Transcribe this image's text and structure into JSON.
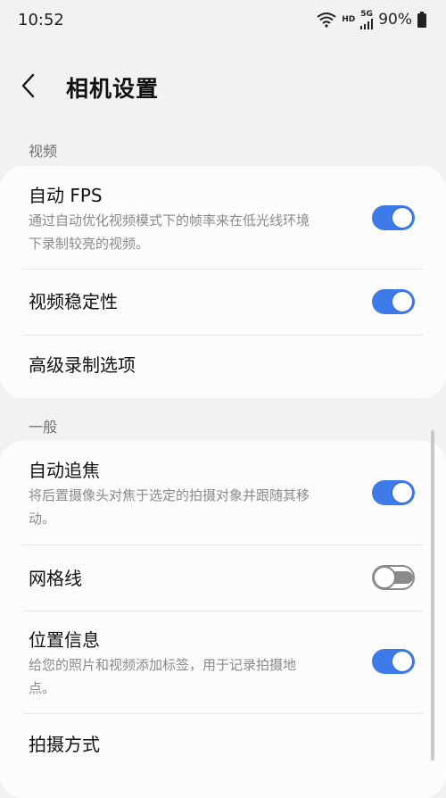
{
  "status_bar": {
    "time": "10:52",
    "hd": "HD",
    "network": "5G",
    "battery": "90%"
  },
  "header": {
    "title": "相机设置"
  },
  "sections": {
    "video": {
      "label": "视频",
      "items": [
        {
          "title": "自动 FPS",
          "subtitle_line1": "通过自动优化视频模式下的帧率来在低光线环境",
          "subtitle_line2": "下录制较亮的视频。",
          "toggle": true
        },
        {
          "title": "视频稳定性",
          "toggle": true
        },
        {
          "title": "高级录制选项"
        }
      ]
    },
    "general": {
      "label": "一般",
      "items": [
        {
          "title": "自动追焦",
          "subtitle_line1": "将后置摄像头对焦于选定的拍摄对象并跟随其移",
          "subtitle_line2": "动。",
          "toggle": true
        },
        {
          "title": "网格线",
          "toggle": false
        },
        {
          "title": "位置信息",
          "subtitle_line1": "给您的照片和视频添加标签，用于记录拍摄地",
          "subtitle_line2": "点。",
          "toggle": true
        },
        {
          "title": "拍摄方式"
        }
      ]
    }
  },
  "colors": {
    "accent": "#3d7be8",
    "background": "#f2f2f2",
    "card": "#fcfcfc"
  }
}
